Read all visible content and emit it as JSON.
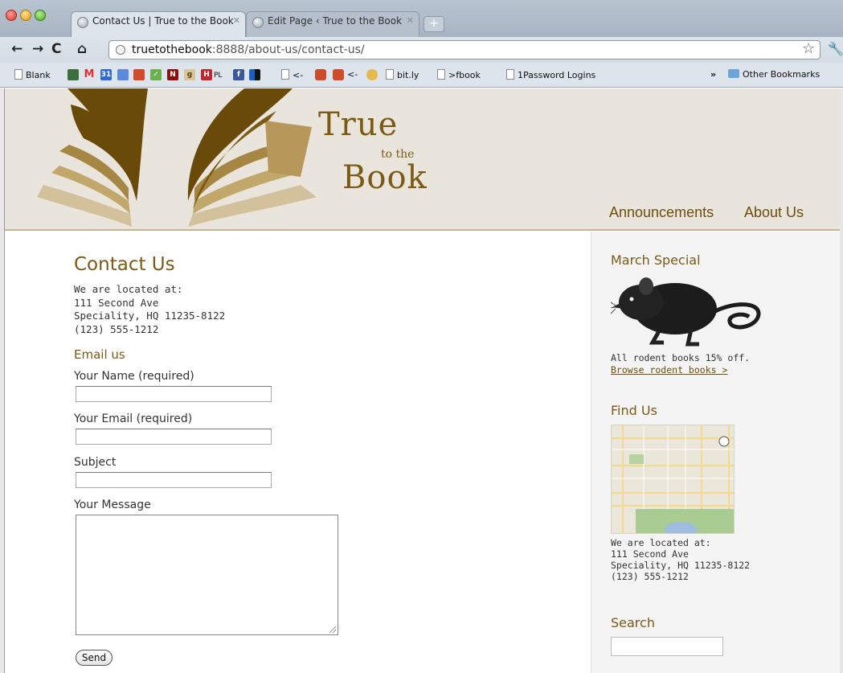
{
  "browser": {
    "tabs": [
      {
        "label": "Contact Us | True to the Book",
        "active": true
      },
      {
        "label": "Edit Page ‹ True to the Book",
        "active": false
      }
    ],
    "url_host": "truetothebook",
    "url_rest": ":8888/about-us/contact-us/",
    "bookmarks": [
      "Blank",
      "PL",
      "<-",
      "<-",
      "bit.ly",
      ">fbook",
      "1Password Logins",
      "Other Bookmarks"
    ],
    "overflow": "»",
    "icon_letters": {
      "gmail": "M",
      "cal": "31",
      "n": "N",
      "g": "g",
      "h": "H",
      "f": "f"
    }
  },
  "site": {
    "logo": {
      "true": "True",
      "tothe": "to the",
      "book": "Book"
    },
    "nav": [
      "Announcements",
      "About Us"
    ]
  },
  "main": {
    "title": "Contact Us",
    "address": "We are located at:\n111 Second Ave\nSpeciality, HQ 11235-8122\n(123) 555-1212",
    "email_heading": "Email us",
    "fields": {
      "name_label": "Your Name (required)",
      "email_label": "Your Email (required)",
      "subject_label": "Subject",
      "message_label": "Your Message"
    },
    "send_label": "Send"
  },
  "sidebar": {
    "special_heading": "March Special",
    "special_text": "All rodent books 15% off.",
    "special_link": "Browse rodent books >",
    "find_heading": "Find Us",
    "find_address": "We are located at:\n111 Second Ave\nSpeciality, HQ 11235-8122\n(123) 555-1212",
    "search_heading": "Search"
  },
  "colors": {
    "brand_brown": "#7a5a14",
    "header_bg": "#e9e5dd",
    "sidebar_bg": "#f4f4f4"
  }
}
